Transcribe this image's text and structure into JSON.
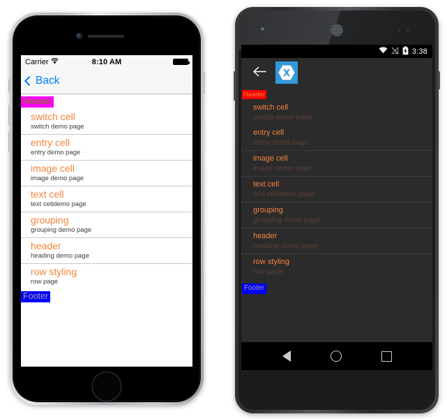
{
  "ios": {
    "status": {
      "carrier": "Carrier",
      "wifi_icon": "wifi-icon",
      "time": "8:10 AM",
      "battery_icon": "battery-full-icon"
    },
    "nav": {
      "back_label": "Back",
      "back_icon": "chevron-left-icon"
    },
    "list": {
      "header": {
        "text": "Header",
        "bg": "#FF00FF",
        "fg": "#808000"
      },
      "footer": {
        "text": "Footer",
        "bg": "#0000FF",
        "fg": "#A0A0A0"
      },
      "title_color": "#F5843C",
      "detail_color": "#3C3C3C",
      "rows": [
        {
          "title": "switch cell",
          "detail": "switch demo page"
        },
        {
          "title": "entry cell",
          "detail": "entry demo page"
        },
        {
          "title": "image cell",
          "detail": "image demo page"
        },
        {
          "title": "text cell",
          "detail": "text celldemo page"
        },
        {
          "title": "grouping",
          "detail": "grouping demo page"
        },
        {
          "title": "header",
          "detail": "heading demo page"
        },
        {
          "title": "row styling",
          "detail": "row page"
        }
      ]
    }
  },
  "android": {
    "status": {
      "wifi_icon": "wifi-icon",
      "signal_icon": "signal-no-sim-icon",
      "battery_icon": "battery-charging-icon",
      "time": "3:38"
    },
    "actionbar": {
      "back_icon": "arrow-left-icon",
      "app_logo": "xamarin-logo-icon",
      "logo_color": "#3498DB"
    },
    "list": {
      "header": {
        "text": "Header",
        "bg": "#FF0000",
        "fg": "#F5843C"
      },
      "footer": {
        "text": "Footer",
        "bg": "#0000FF",
        "fg": "#A0A0A0"
      },
      "title_color": "#F5843C",
      "detail_color": "#5A4038",
      "rows": [
        {
          "title": "switch cell",
          "detail": "switch demo page",
          "separator": false
        },
        {
          "title": "entry cell",
          "detail": "entry demo page",
          "separator": false
        },
        {
          "title": "image cell",
          "detail": "image demo page",
          "separator": true
        },
        {
          "title": "text cell",
          "detail": "text celldemo page",
          "separator": true
        },
        {
          "title": "grouping",
          "detail": "grouping demo page",
          "separator": true
        },
        {
          "title": "header",
          "detail": "heading demo page",
          "separator": true
        },
        {
          "title": "row styling",
          "detail": "row page",
          "separator": true
        }
      ]
    },
    "navbar": {
      "back_icon": "nav-back-triangle-icon",
      "home_icon": "nav-home-circle-icon",
      "recents_icon": "nav-recents-square-icon"
    }
  }
}
